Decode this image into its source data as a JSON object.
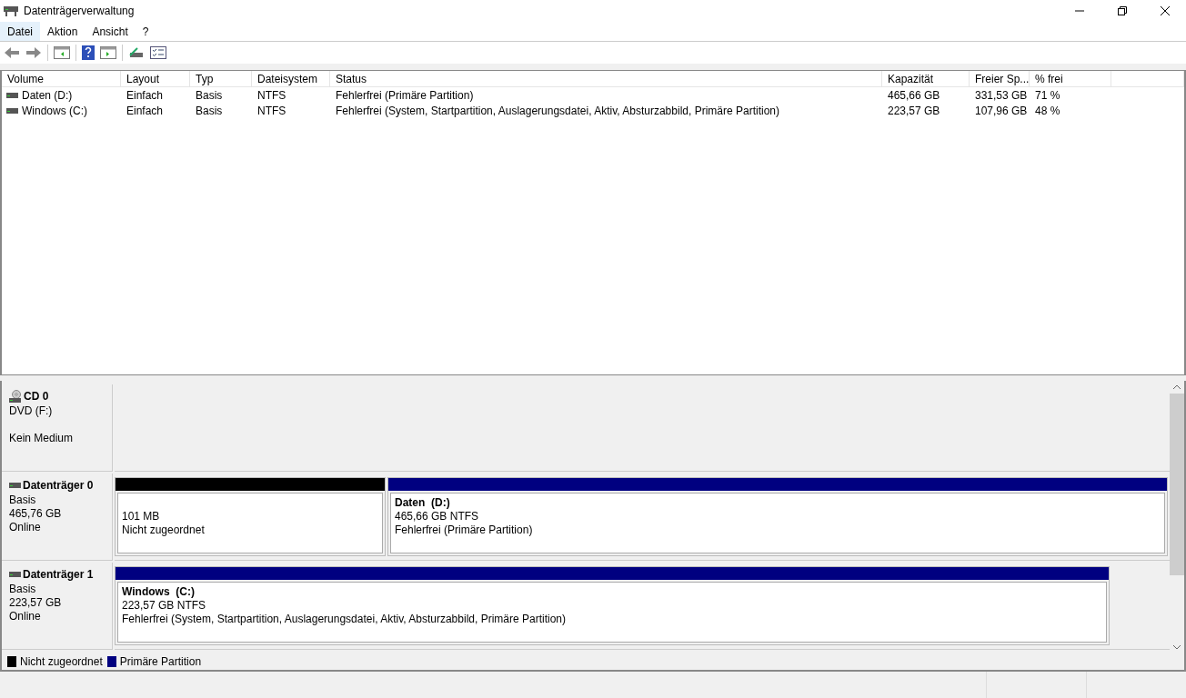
{
  "window": {
    "title": "Datenträgerverwaltung"
  },
  "menu": [
    {
      "label": "Datei",
      "selected": true
    },
    {
      "label": "Aktion",
      "selected": false
    },
    {
      "label": "Ansicht",
      "selected": false
    },
    {
      "label": "?",
      "selected": false
    }
  ],
  "table": {
    "columns": [
      "Volume",
      "Layout",
      "Typ",
      "Dateisystem",
      "Status",
      "Kapazität",
      "Freier Sp...",
      "% frei"
    ],
    "rows": [
      [
        "Daten (D:)",
        "Einfach",
        "Basis",
        "NTFS",
        "Fehlerfrei (Primäre Partition)",
        "465,66 GB",
        "331,53 GB",
        "71 %"
      ],
      [
        "Windows (C:)",
        "Einfach",
        "Basis",
        "NTFS",
        "Fehlerfrei (System, Startpartition, Auslagerungsdatei, Aktiv, Absturzabbild, Primäre Partition)",
        "223,57 GB",
        "107,96 GB",
        "48 %"
      ]
    ]
  },
  "disks": [
    {
      "kind": "cd",
      "name": "CD 0",
      "lines": [
        "DVD (F:)",
        "Kein Medium"
      ]
    },
    {
      "kind": "disk",
      "name": "Datenträger 0",
      "lines": [
        "Basis",
        "465,76 GB",
        "Online"
      ],
      "partitions": [
        {
          "kind": "unallocated",
          "lines": [
            "101 MB",
            "Nicht zugeordnet"
          ]
        },
        {
          "kind": "primary",
          "title": "Daten  (D:)",
          "lines": [
            "465,66 GB NTFS",
            "Fehlerfrei (Primäre Partition)"
          ]
        }
      ]
    },
    {
      "kind": "disk",
      "name": "Datenträger 1",
      "lines": [
        "Basis",
        "223,57 GB",
        "Online"
      ],
      "partitions": [
        {
          "kind": "primary",
          "title": "Windows  (C:)",
          "lines": [
            "223,57 GB NTFS",
            "Fehlerfrei (System, Startpartition, Auslagerungsdatei, Aktiv, Absturzabbild, Primäre Partition)"
          ]
        }
      ]
    }
  ],
  "legend": [
    {
      "label": "Nicht zugeordnet",
      "color": "#000000"
    },
    {
      "label": "Primäre Partition",
      "color": "#000080"
    }
  ]
}
